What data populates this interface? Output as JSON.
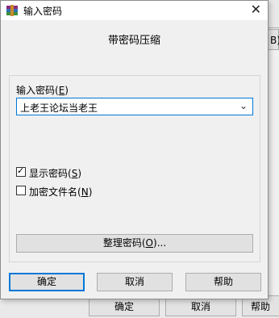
{
  "background": {
    "right_button_text": "B).",
    "ok": "确定",
    "cancel": "取消",
    "help": "帮助"
  },
  "dialog": {
    "title": "输入密码",
    "subtitle": "带密码压缩",
    "password_label": "输入密码",
    "password_label_key": "E",
    "password_value": "上老王论坛当老王",
    "show_password_label": "显示密码",
    "show_password_key": "S",
    "show_password_checked": true,
    "encrypt_filenames_label": "加密文件名",
    "encrypt_filenames_key": "N",
    "encrypt_filenames_checked": false,
    "organize_label": "整理密码",
    "organize_key": "O",
    "organize_suffix": "...",
    "ok": "确定",
    "cancel": "取消",
    "help": "帮助"
  }
}
